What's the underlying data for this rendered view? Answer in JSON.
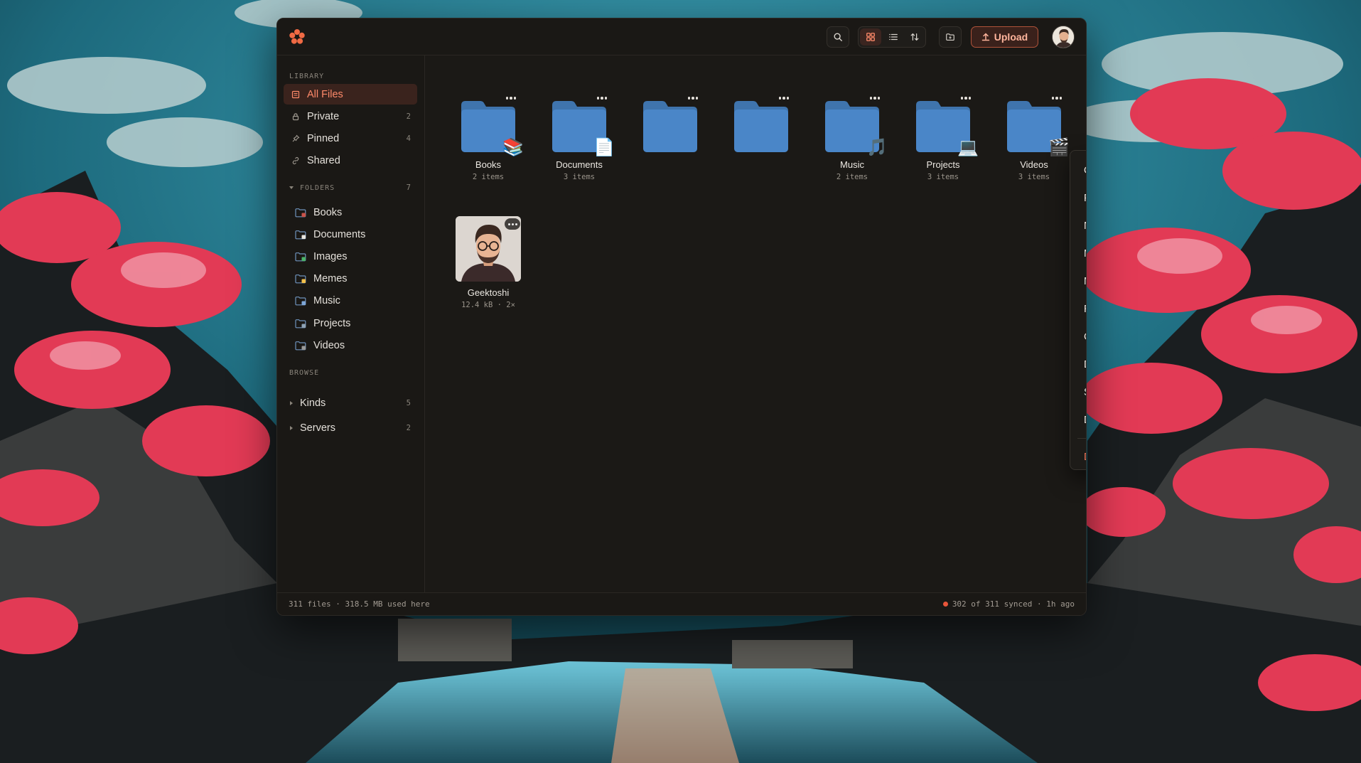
{
  "colors": {
    "accent": "#ff8a6a",
    "folder_blue": "#4a86c8",
    "danger": "#f0775a",
    "sync_dot": "#e8553a"
  },
  "toolbar": {
    "upload_label": "Upload",
    "search_icon": "search-icon",
    "view_grid_icon": "grid-icon",
    "view_list_icon": "list-icon",
    "sort_icon": "sort-icon",
    "new_folder_icon": "folder-icon"
  },
  "sidebar": {
    "library_label": "LIBRARY",
    "library_items": [
      {
        "label": "All Files",
        "count": "",
        "icon": "files-icon"
      },
      {
        "label": "Private",
        "count": "2",
        "icon": "lock-icon"
      },
      {
        "label": "Pinned",
        "count": "4",
        "icon": "pin-icon"
      },
      {
        "label": "Shared",
        "count": "",
        "icon": "link-icon"
      }
    ],
    "folders_label": "FOLDERS",
    "folders_count": "7",
    "folders": [
      {
        "label": "Books",
        "badge": "📚"
      },
      {
        "label": "Documents",
        "badge": "📄"
      },
      {
        "label": "Images",
        "badge": "🖼"
      },
      {
        "label": "Memes",
        "badge": "😂"
      },
      {
        "label": "Music",
        "badge": "🎵"
      },
      {
        "label": "Projects",
        "badge": "💻"
      },
      {
        "label": "Videos",
        "badge": "🎬"
      }
    ],
    "browse_label": "BROWSE",
    "browse_items": [
      {
        "label": "Kinds",
        "count": "5"
      },
      {
        "label": "Servers",
        "count": "2"
      }
    ]
  },
  "grid": {
    "folders": [
      {
        "name": "Books",
        "meta": "2 items",
        "emoji": "📚"
      },
      {
        "name": "Documents",
        "meta": "3 items",
        "emoji": "📄"
      },
      {
        "name": "",
        "meta": "",
        "emoji": ""
      },
      {
        "name": "",
        "meta": "",
        "emoji": ""
      },
      {
        "name": "Music",
        "meta": "2 items",
        "emoji": "🎵"
      },
      {
        "name": "Projects",
        "meta": "3 items",
        "emoji": "💻"
      },
      {
        "name": "Videos",
        "meta": "3 items",
        "emoji": "🎬"
      }
    ],
    "file": {
      "name": "Geektoshi",
      "meta": "12.4 kB · 2×"
    }
  },
  "context_menu": {
    "items": [
      "Open",
      "Pin",
      "New subfolder...",
      "Move folder...",
      "Merge into...",
      "Rename folder...",
      "Customize...",
      "Download as zip",
      "Share...",
      "Don't allow sharing"
    ],
    "danger_item": "Delete folder"
  },
  "statusbar": {
    "left": "311 files · 318.5 MB used here",
    "right": "302 of 311 synced · 1h ago"
  }
}
